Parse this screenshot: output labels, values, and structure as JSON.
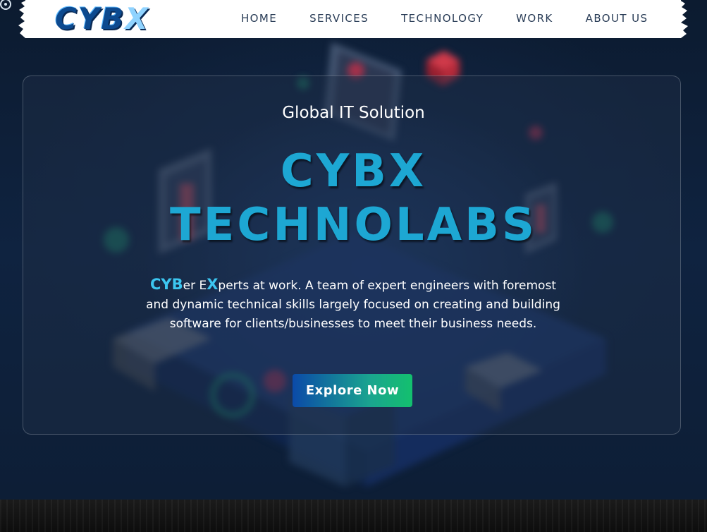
{
  "header": {
    "logo_main": "CYB",
    "logo_x": "X",
    "nav": [
      {
        "label": "HOME"
      },
      {
        "label": "SERVICES"
      },
      {
        "label": "TECHNOLOGY"
      },
      {
        "label": "WORK"
      },
      {
        "label": "ABOUT US"
      }
    ]
  },
  "hero": {
    "eyebrow": "Global IT Solution",
    "title_line1": "CYBX",
    "title_line2": "TECHNOLABS",
    "desc_hl1": "CYB",
    "desc_part1": "er E",
    "desc_hl2": "X",
    "desc_part2": "perts at work. A team of expert engineers with foremost and dynamic technical skills largely focused on creating and building software for clients/businesses to meet their business needs.",
    "cta_label": "Explore Now"
  },
  "colors": {
    "accent": "#1da7d3",
    "highlight": "#3cc6f0",
    "nav_text": "#2a3d57",
    "cta_start": "#0b4aa8",
    "cta_end": "#13c06e"
  }
}
